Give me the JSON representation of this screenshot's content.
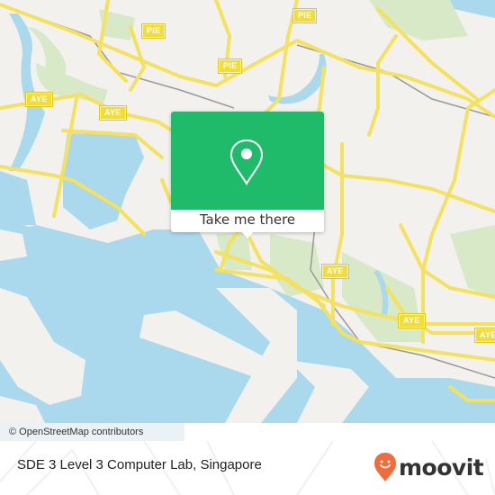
{
  "map": {
    "highway_shields": [
      {
        "label": "PIE"
      },
      {
        "label": "PIE"
      },
      {
        "label": "PIE"
      },
      {
        "label": "AYE"
      },
      {
        "label": "AYE"
      },
      {
        "label": "AYE"
      },
      {
        "label": "AYE"
      },
      {
        "label": "AYE"
      }
    ],
    "colors": {
      "land": "#f2f1ee",
      "water": "#aad8ec",
      "park": "#d4e8c2",
      "road": "#f4e15e",
      "popup_green": "#1fbb6a"
    }
  },
  "popup": {
    "icon": "map-pin-icon",
    "button_label": "Take me there"
  },
  "attribution": "© OpenStreetMap contributors",
  "footer": {
    "place_name": "SDE 3 Level 3 Computer Lab, Singapore",
    "brand": "moovit",
    "brand_icon": "moovit-pin-smile-icon",
    "brand_color": "#f26b3a"
  }
}
